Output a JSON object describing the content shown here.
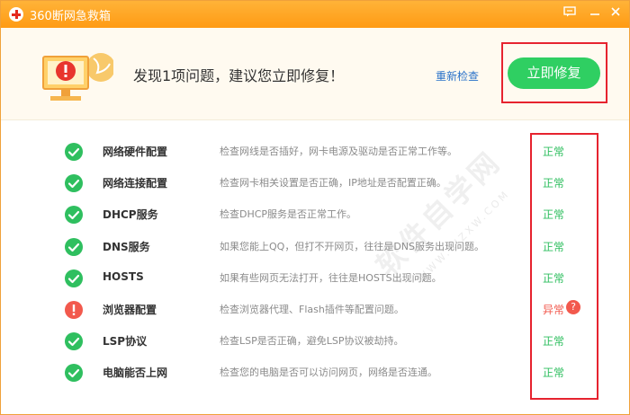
{
  "window": {
    "title": "360断网急救箱"
  },
  "header": {
    "headline": "发现1项问题，建议您立即修复！",
    "rescan_label": "重新检查",
    "fix_label": "立即修复"
  },
  "items": [
    {
      "name": "网络硬件配置",
      "desc": "检查网线是否插好，网卡电源及驱动是否正常工作等。",
      "status": "正常",
      "state": "ok"
    },
    {
      "name": "网络连接配置",
      "desc": "检查网卡相关设置是否正确，IP地址是否配置正确。",
      "status": "正常",
      "state": "ok"
    },
    {
      "name": "DHCP服务",
      "desc": "检查DHCP服务是否正常工作。",
      "status": "正常",
      "state": "ok"
    },
    {
      "name": "DNS服务",
      "desc": "如果您能上QQ，但打不开网页，往往是DNS服务出现问题。",
      "status": "正常",
      "state": "ok"
    },
    {
      "name": "HOSTS",
      "desc": "如果有些网页无法打开，往往是HOSTS出现问题。",
      "status": "正常",
      "state": "ok"
    },
    {
      "name": "浏览器配置",
      "desc": "检查浏览器代理、Flash插件等配置问题。",
      "status": "异常",
      "state": "warn"
    },
    {
      "name": "LSP协议",
      "desc": "检查LSP是否正确，避免LSP协议被劫持。",
      "status": "正常",
      "state": "ok"
    },
    {
      "name": "电脑能否上网",
      "desc": "检查您的电脑是否可以访问网页，网络是否连通。",
      "status": "正常",
      "state": "ok"
    }
  ],
  "watermark": {
    "text": "软件自学网",
    "url": "WWW.RJZXW.COM"
  },
  "colors": {
    "titlebar": "#ff9b14",
    "ok": "#2fbf5f",
    "warn": "#f2594d",
    "fix_button": "#2fcf62",
    "link": "#2a72c9",
    "highlight": "#e6232f"
  }
}
